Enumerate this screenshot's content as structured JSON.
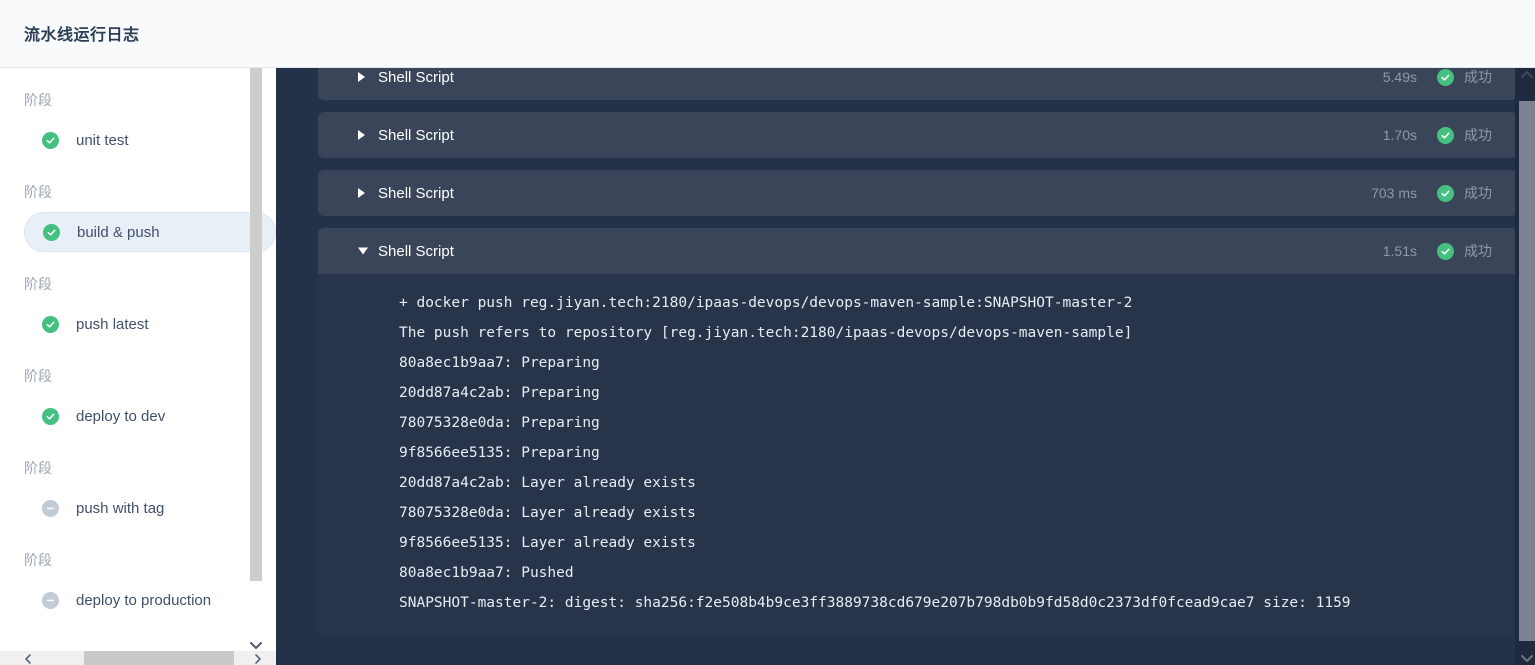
{
  "header": {
    "title": "流水线运行日志"
  },
  "sidebar": {
    "stage_label": "阶段",
    "stages": [
      {
        "group_label": "阶段",
        "name": "unit test",
        "status": "success",
        "selected": false
      },
      {
        "group_label": "阶段",
        "name": "build & push",
        "status": "success",
        "selected": true
      },
      {
        "group_label": "阶段",
        "name": "push latest",
        "status": "success",
        "selected": false
      },
      {
        "group_label": "阶段",
        "name": "deploy to dev",
        "status": "success",
        "selected": false
      },
      {
        "group_label": "阶段",
        "name": "push with tag",
        "status": "skipped",
        "selected": false
      },
      {
        "group_label": "阶段",
        "name": "deploy to production",
        "status": "skipped",
        "selected": false
      }
    ],
    "icons": {
      "success": "check-circle-icon",
      "skipped": "minus-circle-icon",
      "scroll_down": "chevron-down-icon",
      "scroll_left": "chevron-left-icon",
      "scroll_right": "chevron-right-icon"
    }
  },
  "main": {
    "steps": [
      {
        "title": "Shell Script",
        "duration": "5.49s",
        "status_text": "成功",
        "expanded": false,
        "caret": "caret-right-icon",
        "log": []
      },
      {
        "title": "Shell Script",
        "duration": "1.70s",
        "status_text": "成功",
        "expanded": false,
        "caret": "caret-right-icon",
        "log": []
      },
      {
        "title": "Shell Script",
        "duration": "703 ms",
        "status_text": "成功",
        "expanded": false,
        "caret": "caret-right-icon",
        "log": []
      },
      {
        "title": "Shell Script",
        "duration": "1.51s",
        "status_text": "成功",
        "expanded": true,
        "caret": "caret-down-icon",
        "log": [
          "+ docker push reg.jiyan.tech:2180/ipaas-devops/devops-maven-sample:SNAPSHOT-master-2",
          "The push refers to repository [reg.jiyan.tech:2180/ipaas-devops/devops-maven-sample]",
          "80a8ec1b9aa7: Preparing",
          "20dd87a4c2ab: Preparing",
          "78075328e0da: Preparing",
          "9f8566ee5135: Preparing",
          "20dd87a4c2ab: Layer already exists",
          "78075328e0da: Layer already exists",
          "9f8566ee5135: Layer already exists",
          "80a8ec1b9aa7: Pushed",
          "SNAPSHOT-master-2: digest: sha256:f2e508b4b9ce3ff3889738cd679e207b798db0b9fd58d0c2373df0fcead9cae7 size: 1159"
        ]
      }
    ],
    "status_icon": "check-circle-icon",
    "scrollbar": {
      "up_icon": "chevron-up-icon",
      "down_icon": "chevron-down-icon"
    }
  },
  "colors": {
    "success_green": "#45c080",
    "skipped_gray": "#c2cbd6",
    "panel_bg": "#233149",
    "step_header_bg": "#3a4559",
    "log_bg": "#27344a",
    "muted_text": "#8e99ab",
    "selected_item_bg": "#e9eff6"
  }
}
